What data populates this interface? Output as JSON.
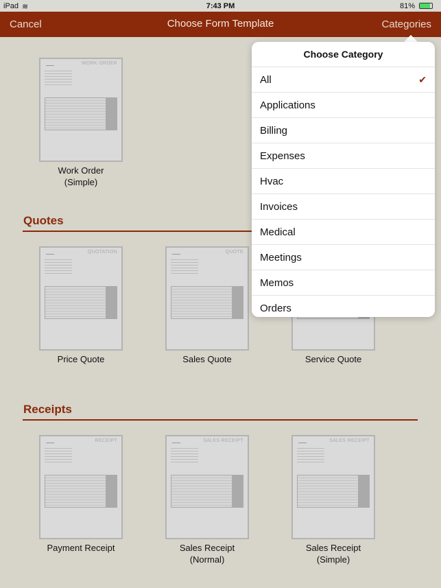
{
  "status": {
    "device": "iPad",
    "time": "7:43 PM",
    "battery": "81%",
    "battery_level": 0.81
  },
  "nav": {
    "cancel": "Cancel",
    "title": "Choose Form Template",
    "categories": "Categories"
  },
  "colors": {
    "accent": "#8a2a0a",
    "background": "#d7d4ca"
  },
  "sections": [
    {
      "title": "",
      "templates": [
        {
          "label": "Work Order (Simple)",
          "lines": [
            "Work Order",
            "(Simple)"
          ],
          "thumb_title": "WORK ORDER"
        }
      ]
    },
    {
      "title": "Quotes",
      "templates": [
        {
          "lines": [
            "Price Quote"
          ],
          "thumb_title": "QUOTATION"
        },
        {
          "lines": [
            "Sales Quote"
          ],
          "thumb_title": "QUOTE"
        },
        {
          "lines": [
            "Service Quote"
          ],
          "thumb_title": ""
        }
      ]
    },
    {
      "title": "Receipts",
      "templates": [
        {
          "lines": [
            "Payment Receipt"
          ],
          "thumb_title": "RECEIPT"
        },
        {
          "lines": [
            "Sales Receipt",
            "(Normal)"
          ],
          "thumb_title": "SALES RECEIPT"
        },
        {
          "lines": [
            "Sales Receipt",
            "(Simple)"
          ],
          "thumb_title": "SALES RECEIPT"
        }
      ]
    }
  ],
  "popover": {
    "title": "Choose Category",
    "items": [
      "All",
      "Applications",
      "Billing",
      "Expenses",
      "Hvac",
      "Invoices",
      "Medical",
      "Meetings",
      "Memos",
      "Orders"
    ],
    "selected": "All"
  }
}
